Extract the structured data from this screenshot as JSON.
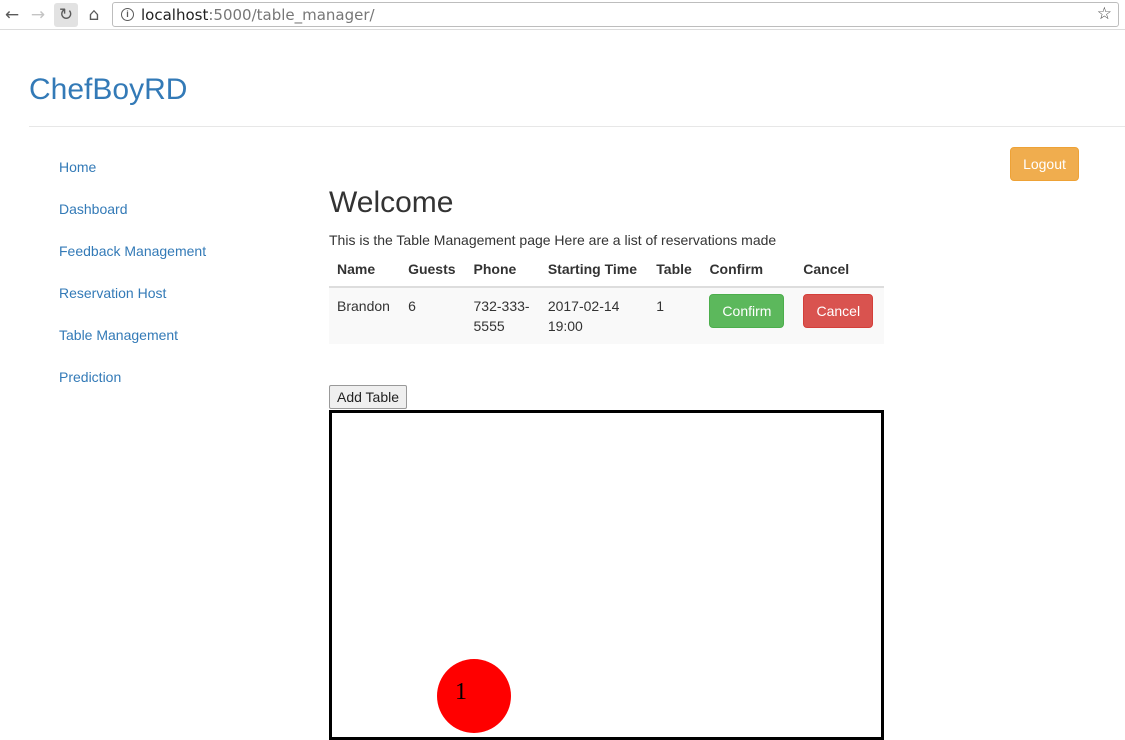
{
  "browser": {
    "url_host": "localhost",
    "url_path": ":5000/table_manager/"
  },
  "brand": "ChefBoyRD",
  "sidebar": {
    "items": [
      {
        "label": "Home"
      },
      {
        "label": "Dashboard"
      },
      {
        "label": "Feedback Management"
      },
      {
        "label": "Reservation Host"
      },
      {
        "label": "Table Management"
      },
      {
        "label": "Prediction"
      }
    ]
  },
  "header": {
    "logout_label": "Logout"
  },
  "main": {
    "title": "Welcome",
    "intro": "This is the Table Management page Here are a list of reservations made",
    "table": {
      "headers": [
        "Name",
        "Guests",
        "Phone",
        "Starting Time",
        "Table",
        "Confirm",
        "Cancel"
      ],
      "rows": [
        {
          "name": "Brandon",
          "guests": "6",
          "phone_line1": "732-333-",
          "phone_line2": "5555",
          "time_line1": "2017-02-14",
          "time_line2": "19:00",
          "table": "1",
          "confirm_label": "Confirm",
          "cancel_label": "Cancel"
        }
      ]
    },
    "add_table_label": "Add Table",
    "floor_plan": {
      "tables": [
        {
          "number": "1",
          "color": "#ff0000"
        }
      ]
    }
  },
  "colors": {
    "link": "#337ab7",
    "logout": "#f0ad4e",
    "confirm": "#5cb85c",
    "cancel": "#d9534f"
  }
}
